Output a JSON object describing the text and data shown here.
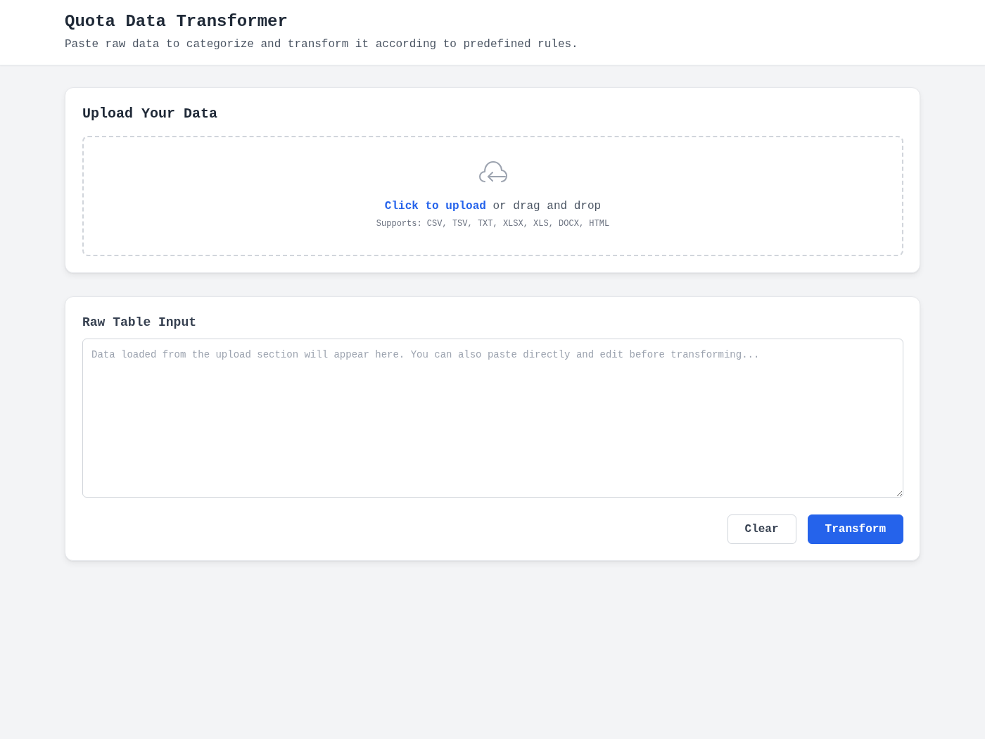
{
  "header": {
    "title": "Quota Data Transformer",
    "subtitle": "Paste raw data to categorize and transform it according to predefined rules."
  },
  "upload_card": {
    "title": "Upload Your Data",
    "dropzone": {
      "link": "Click to upload",
      "text": "or drag and drop",
      "supports": "Supports: CSV, TSV, TXT, XLSX, XLS, DOCX, HTML"
    }
  },
  "input_card": {
    "title": "Raw Table Input",
    "textarea": {
      "placeholder": "Data loaded from the upload section will appear here. You can also paste directly and edit before transforming..."
    },
    "buttons": [
      {
        "label": "Clear",
        "kind": "secondary"
      },
      {
        "label": "Transform",
        "kind": "primary"
      }
    ]
  }
}
